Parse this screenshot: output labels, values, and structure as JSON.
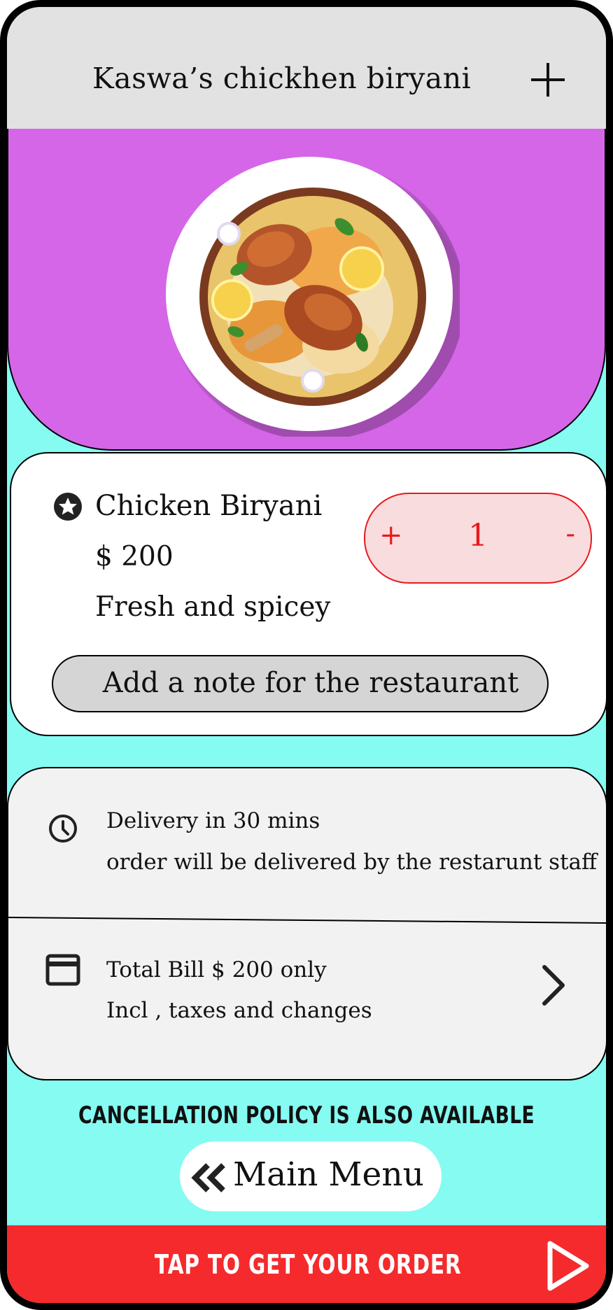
{
  "header": {
    "title": "Kaswa’s chickhen biryani",
    "add_icon": "plus-icon"
  },
  "hero": {
    "image": "chicken-biryani-plate"
  },
  "item": {
    "name": "Chicken Biryani",
    "price": "$ 200",
    "description": "Fresh and spicey",
    "badge_icon": "star-icon",
    "quantity": {
      "plus": "+",
      "value": "1",
      "minus": "-"
    },
    "note_button": "Add a note for the restaurant"
  },
  "delivery": {
    "icon": "clock-icon",
    "title": "Delivery in 30 mins",
    "subtitle": "order will be delivered by the restarunt staff"
  },
  "bill": {
    "icon": "credit-card-icon",
    "title": "Total Bill $ 200 only",
    "subtitle": "Incl , taxes and changes",
    "chevron": "chevron-right-icon"
  },
  "policy_text": "CANCELLATION POLICY IS ALSO AVAILABLE",
  "main_menu": {
    "icon": "double-chevron-left-icon",
    "label": "Main Menu"
  },
  "footer": {
    "label": "TAP TO GET YOUR ORDER",
    "icon": "play-icon"
  },
  "colors": {
    "background": "#85fbf2",
    "header": "#e2e2e2",
    "hero": "#d566e8",
    "accent_red": "#f52a2c",
    "quantity_bg": "#f9dcdd",
    "quantity_text": "#e8191f"
  }
}
